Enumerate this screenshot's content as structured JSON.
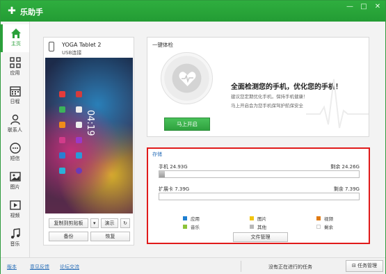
{
  "app": {
    "title": "乐助手",
    "logo_glyph": "✚"
  },
  "window_controls": {
    "minimize": "—",
    "maximize": "□",
    "close": "✕"
  },
  "sidebar": {
    "items": [
      {
        "label": "主页",
        "icon": "home-icon",
        "active": true
      },
      {
        "label": "应用",
        "icon": "apps-grid-icon"
      },
      {
        "label": "日程",
        "icon": "calendar-icon"
      },
      {
        "label": "联系人",
        "icon": "contact-icon"
      },
      {
        "label": "短信",
        "icon": "sms-bubble-icon"
      },
      {
        "label": "图片",
        "icon": "picture-icon"
      },
      {
        "label": "视频",
        "icon": "video-icon"
      },
      {
        "label": "音乐",
        "icon": "music-note-icon"
      }
    ]
  },
  "device": {
    "name": "YOGA Tablet 2",
    "connection": "USB连接",
    "clock": "04:19",
    "buttons": {
      "copy": "复制到剪贴板",
      "dropdown": "▾",
      "demo": "演示",
      "refresh": "↻",
      "backup": "备份",
      "restore": "恢复"
    }
  },
  "health_check": {
    "title": "一键体检",
    "headline": "全面检测您的手机，优化您的手机！",
    "sub1": "建议您定期优化手机，保持手机健康！",
    "sub2": "马上开启会为您手机保驾护航保安全",
    "start_button": "马上开启"
  },
  "storage": {
    "title": "存储",
    "phone": {
      "label": "手机 24.93G",
      "remaining": "剩余 24.26G",
      "used_fraction": 0.027
    },
    "sdcard": {
      "label": "扩展卡 7.39G",
      "remaining": "剩余 7.39G",
      "used_fraction": 0.0
    },
    "legend": [
      {
        "label": "应用",
        "color": "#1e7fd1"
      },
      {
        "label": "图片",
        "color": "#f2c50f"
      },
      {
        "label": "视频",
        "color": "#e07a12"
      },
      {
        "label": "音乐",
        "color": "#8cc33a"
      },
      {
        "label": "其他",
        "color": "#b8b8b8"
      },
      {
        "label": "剩余",
        "color": "#ffffff"
      }
    ],
    "file_button": "文件管理"
  },
  "bottom": {
    "links": [
      "版本",
      "意见反馈",
      "论坛交流"
    ],
    "status": "没有正在进行的任务",
    "task_button": "任务管理"
  }
}
